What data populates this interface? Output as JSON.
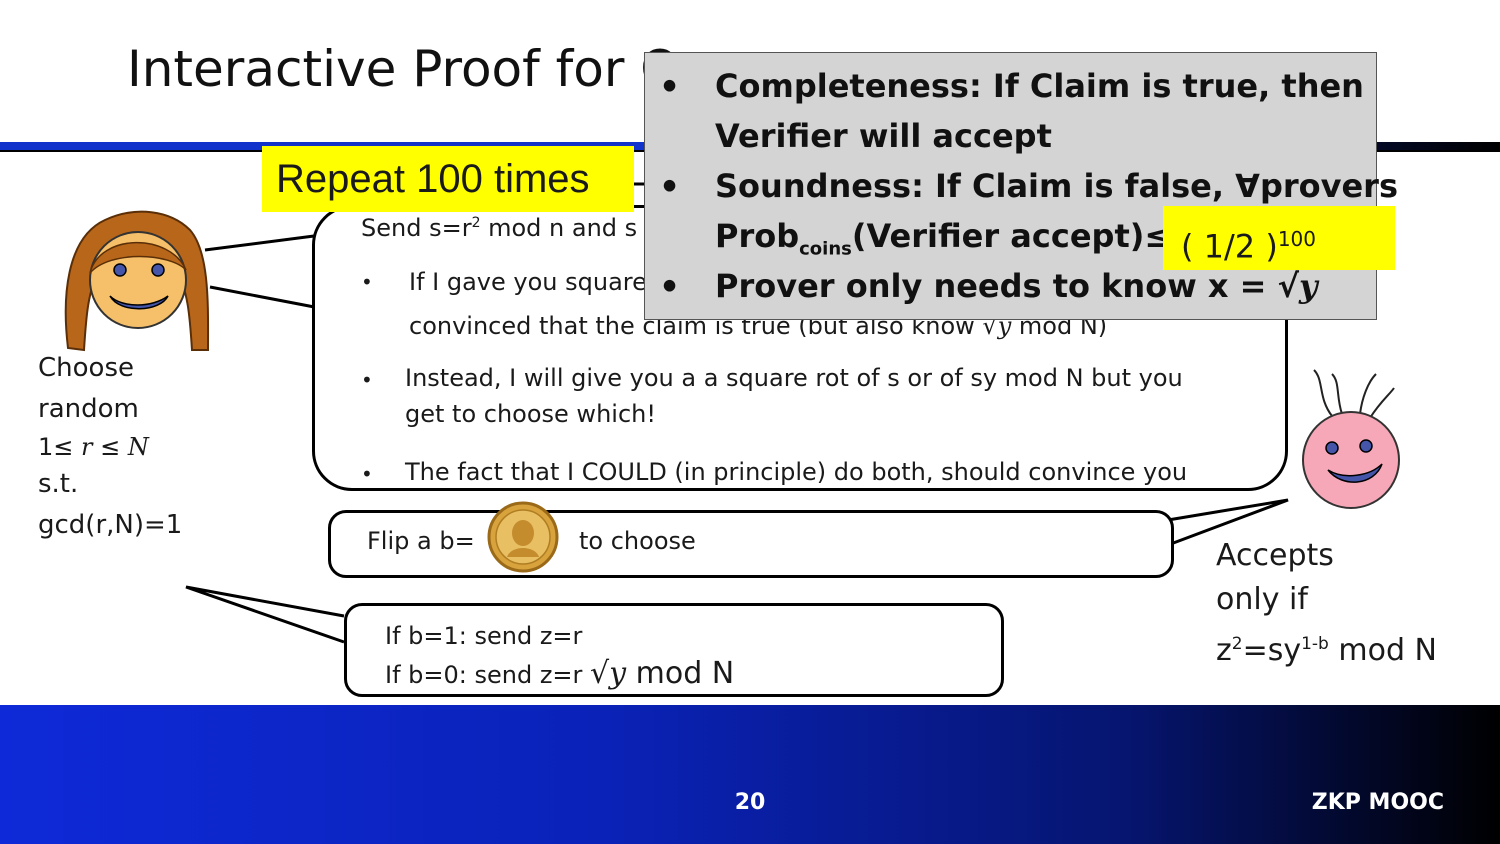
{
  "slide": {
    "title": "Interactive Proof for Q",
    "slide_number": "20",
    "course": "ZKP MOOC"
  },
  "repeat_label": "Repeat 100 times",
  "prover_bubble": {
    "line1_prefix": "Send s=r",
    "line1_sup": "2",
    "line1_suffix": " mod n and s",
    "bullet1_line1": "If I gave you square",
    "bullet1_line2": "convinced that the claim is true (but also know √",
    "bullet1_var": "y",
    "bullet1_tail": " mod N)",
    "bullet2_line1": "Instead, I will give you a  a square rot of s or of sy mod N but you",
    "bullet2_line2": "get to choose which!",
    "bullet3": "The fact that I COULD (in principle) do both, should convince you",
    "bullet_glyph": "•"
  },
  "properties_box": {
    "bullet_glyph": "•",
    "completeness_line1": "Completeness: If Claim is true, then",
    "completeness_line2": "Verifier will accept",
    "soundness_line1": "Soundness: If Claim is false, ∀provers",
    "soundness_prob": "Prob",
    "soundness_sub": "coins",
    "soundness_tail": "(Verifier accept)≤",
    "prover_knows": "Prover only needs to know x = √",
    "prover_var": "y"
  },
  "probability_highlight": {
    "base": "( 1/2 )",
    "exponent": "100"
  },
  "prover_side": {
    "choose": "Choose",
    "random": "random",
    "range_prefix": "1≤ ",
    "range_var": "r",
    "range_mid": " ≤ ",
    "range_var2": "N",
    "st": "s.t.",
    "gcd": "gcd(r,N)=1"
  },
  "challenge_bubble": {
    "prefix": "Flip a  b=",
    "suffix": "to choose"
  },
  "response_bubble": {
    "line1": "If b=1: send z=r",
    "line2_prefix": "If b=0: send z=r ",
    "line2_root": "√",
    "line2_var": "y",
    "line2_suffix": " mod N"
  },
  "verifier_side": {
    "line1": "Accepts",
    "line2": "only  if",
    "line3_prefix": "z",
    "line3_sup1": "2",
    "line3_mid": "=sy",
    "line3_sup2": "1-b",
    "line3_suffix": " mod N"
  },
  "colors": {
    "highlight": "#ffff00",
    "accent_blue": "#1133cc",
    "prover_face": "#f6c06a",
    "prover_hair": "#b8661a",
    "verifier_face": "#f7a8b8",
    "coin": "#d8a23c",
    "gray_panel": "#d4d4d4"
  }
}
